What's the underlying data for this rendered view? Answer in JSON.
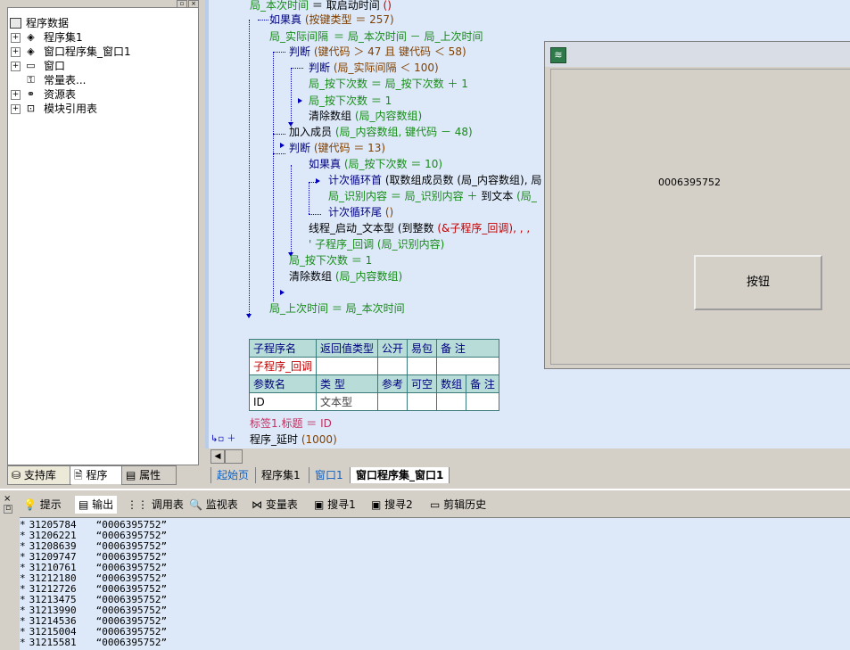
{
  "tree": {
    "root": "程序数据",
    "items": [
      {
        "label": "程序集1",
        "icon": "program-set-icon",
        "expandable": true
      },
      {
        "label": "窗口程序集_窗口1",
        "icon": "program-set-icon",
        "expandable": true
      },
      {
        "label": "窗口",
        "icon": "window-icon",
        "expandable": true
      },
      {
        "label": "常量表...",
        "icon": "constant-table-icon",
        "expandable": false
      },
      {
        "label": "资源表",
        "icon": "resource-icon",
        "expandable": true
      },
      {
        "label": "模块引用表",
        "icon": "module-icon",
        "expandable": true
      }
    ]
  },
  "left_tabs": [
    "支持库",
    "程序",
    "属性"
  ],
  "code": {
    "l0_a": "局_本次时间",
    "l0_op": "＝",
    "l0_b": "取启动时间",
    "l0_c": "()",
    "l1_kw": "如果真",
    "l1_args": "(按键类型 ＝ 257)",
    "l2_a": "局_实际间隔",
    "l2_b": "＝ 局_本次时间 － 局_上次时间",
    "l3_kw": "判断",
    "l3_args": "(键代码 ＞ 47 且 键代码 ＜ 58)",
    "l4_kw": "判断",
    "l4_args": "(局_实际间隔 ＜ 100)",
    "l5": "局_按下次数 ＝ 局_按下次数 ＋ 1",
    "l6": "局_按下次数 ＝ 1",
    "l7_a": "清除数组",
    "l7_b": "(局_内容数组)",
    "l8_a": "加入成员",
    "l8_b": "(局_内容数组, 键代码 － 48)",
    "l9_kw": "判断",
    "l9_args": "(键代码 ＝ 13)",
    "l10_kw": "如果真",
    "l10_args": "(局_按下次数 ＝ 10)",
    "l11_kw": "计次循环首",
    "l11_args": "(取数组成员数 (局_内容数组), 局",
    "l12_a": "局_识别内容 ＝ 局_识别内容 ＋",
    "l12_b": "到文本",
    "l12_c": "(局_",
    "l13_kw": "计次循环尾",
    "l13_args": "()",
    "l14_a": "线程_启动_文本型",
    "l14_b": "(到整数",
    "l14_c": "(&子程序_回调), , ,",
    "l15": "' 子程序_回调 (局_识别内容)",
    "l16": "局_按下次数 ＝ 1",
    "l17_a": "清除数组",
    "l17_b": "(局_内容数组)",
    "l18": "局_上次时间 ＝ 局_本次时间"
  },
  "sub_table": {
    "headers": [
      "子程序名",
      "返回值类型",
      "公开",
      "易包",
      "备 注"
    ],
    "name": "子程序_回调",
    "param_headers": [
      "参数名",
      "类 型",
      "参考",
      "可空",
      "数组",
      "备 注"
    ],
    "param_name": "ID",
    "param_type": "文本型"
  },
  "after_table": {
    "line1": "标签1.标题 ＝ ID",
    "line2_a": "程序_延时",
    "line2_b": "(1000)"
  },
  "form": {
    "label_text": "0006395752",
    "button_label": "按钮"
  },
  "editor_tabs": [
    "起始页",
    "程序集1",
    "窗口1",
    "窗口程序集_窗口1"
  ],
  "bottom_tabs": [
    "提示",
    "输出",
    "调用表",
    "监视表",
    "变量表",
    "搜寻1",
    "搜寻2",
    "剪辑历史"
  ],
  "output_rows": [
    {
      "id": "31205784",
      "val": "“0006395752”"
    },
    {
      "id": "31206221",
      "val": "“0006395752”"
    },
    {
      "id": "31208639",
      "val": "“0006395752”"
    },
    {
      "id": "31209747",
      "val": "“0006395752”"
    },
    {
      "id": "31210761",
      "val": "“0006395752”"
    },
    {
      "id": "31212180",
      "val": "“0006395752”"
    },
    {
      "id": "31212726",
      "val": "“0006395752”"
    },
    {
      "id": "31213475",
      "val": "“0006395752”"
    },
    {
      "id": "31213990",
      "val": "“0006395752”"
    },
    {
      "id": "31214536",
      "val": "“0006395752”"
    },
    {
      "id": "31215004",
      "val": "“0006395752”"
    },
    {
      "id": "31215581",
      "val": "“0006395752”"
    }
  ],
  "output_prefix": "*"
}
